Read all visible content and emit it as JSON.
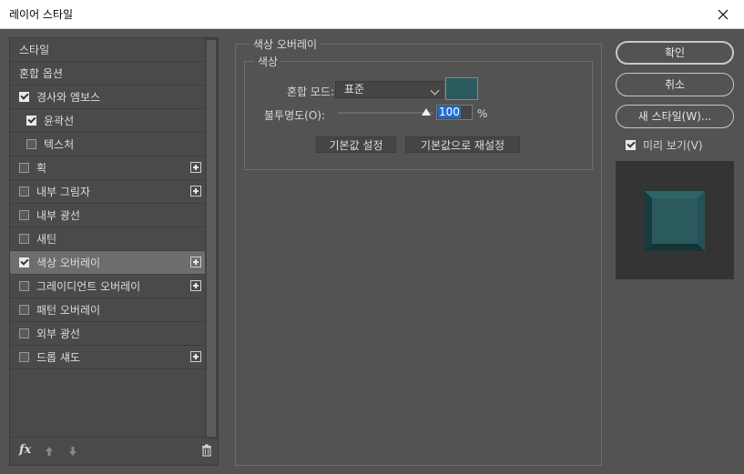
{
  "window": {
    "title": "레이어 스타일"
  },
  "styles": {
    "items": [
      {
        "label": "스타일",
        "checkbox": false,
        "checked": false,
        "plus": false,
        "indent": 0
      },
      {
        "label": "혼합 옵션",
        "checkbox": false,
        "checked": false,
        "plus": false,
        "indent": 0
      },
      {
        "label": "경사와 엠보스",
        "checkbox": true,
        "checked": true,
        "plus": false,
        "indent": 0
      },
      {
        "label": "윤곽선",
        "checkbox": true,
        "checked": true,
        "plus": false,
        "indent": 1
      },
      {
        "label": "텍스처",
        "checkbox": true,
        "checked": false,
        "plus": false,
        "indent": 1
      },
      {
        "label": "획",
        "checkbox": true,
        "checked": false,
        "plus": true,
        "indent": 0
      },
      {
        "label": "내부 그림자",
        "checkbox": true,
        "checked": false,
        "plus": true,
        "indent": 0
      },
      {
        "label": "내부 광선",
        "checkbox": true,
        "checked": false,
        "plus": false,
        "indent": 0
      },
      {
        "label": "새틴",
        "checkbox": true,
        "checked": false,
        "plus": false,
        "indent": 0
      },
      {
        "label": "색상 오버레이",
        "checkbox": true,
        "checked": true,
        "plus": true,
        "indent": 0,
        "selected": true
      },
      {
        "label": "그레이디언트 오버레이",
        "checkbox": true,
        "checked": false,
        "plus": true,
        "indent": 0
      },
      {
        "label": "패턴 오버레이",
        "checkbox": true,
        "checked": false,
        "plus": false,
        "indent": 0
      },
      {
        "label": "외부 광선",
        "checkbox": true,
        "checked": false,
        "plus": false,
        "indent": 0
      },
      {
        "label": "드롭 섀도",
        "checkbox": true,
        "checked": false,
        "plus": true,
        "indent": 0
      }
    ],
    "footer": {
      "fx_label": "fx",
      "fx_icon": "fx-icon",
      "up_icon": "arrow-up-icon",
      "down_icon": "arrow-down-icon",
      "delete_icon": "trash-icon"
    }
  },
  "color_overlay": {
    "group_title": "색상 오버레이",
    "subgroup_title": "색상",
    "blend_mode_label": "혼합 모드:",
    "blend_mode_value": "표준",
    "overlay_color": "#2b5a5e",
    "opacity_label": "불투명도(O):",
    "opacity_value": "100",
    "opacity_unit": "%",
    "opacity_fraction": 1.0,
    "set_default_label": "기본값 설정",
    "reset_default_label": "기본값으로 재설정"
  },
  "actions": {
    "ok_label": "확인",
    "cancel_label": "취소",
    "new_style_label": "새 스타일(W)...",
    "preview_label": "미리 보기(V)",
    "preview_checked": true
  },
  "colors": {
    "dialog_bg": "#535353",
    "preview_bg": "#343434",
    "preview_face": "#2b5a5e",
    "accent_selection": "#1f6fd1"
  }
}
